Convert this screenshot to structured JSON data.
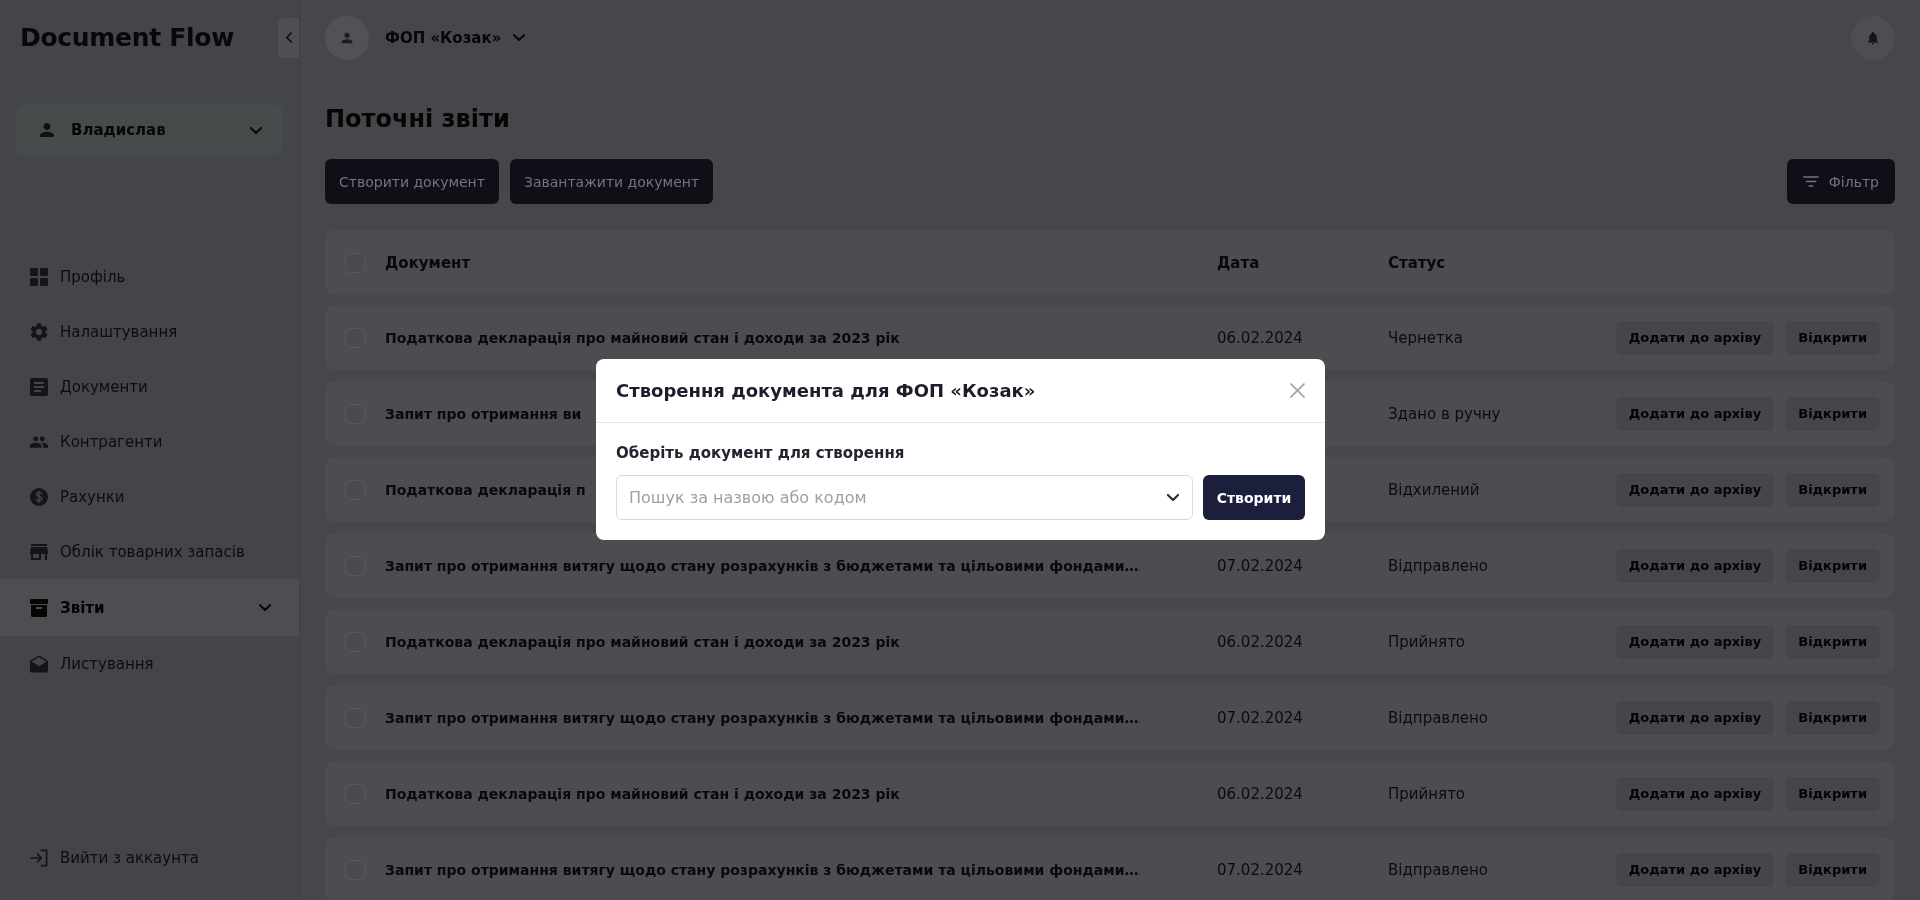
{
  "sidebar": {
    "logo": "Document Flow",
    "user": {
      "name": "Владислав"
    },
    "items": [
      {
        "label": "Профіль",
        "kind": "link",
        "selected": false
      },
      {
        "label": "Налаштування",
        "kind": "link",
        "selected": false
      },
      {
        "label": "Документи",
        "kind": "link",
        "selected": false
      },
      {
        "label": "Контрагенти",
        "kind": "link",
        "selected": false
      },
      {
        "label": "Рахунки",
        "kind": "link",
        "selected": false
      },
      {
        "label": "Облік товарних запасів",
        "kind": "link",
        "selected": false
      },
      {
        "label": "Звіти",
        "kind": "group",
        "selected": true
      },
      {
        "label": "Листування",
        "kind": "link",
        "selected": false
      }
    ],
    "logout": "Вийти з аккаунта"
  },
  "header": {
    "company": "ФОП «Козак»"
  },
  "page": {
    "title": "Поточні звіти",
    "actions": [
      "Створити документ",
      "Завантажити документ"
    ],
    "filter": "Фільтр"
  },
  "table": {
    "columns": [
      "Документ",
      "Дата",
      "Статус"
    ],
    "all_checked": false,
    "rows": [
      {
        "checked": false,
        "document": "Податкова декларація про майновий стан і доходи за 2023 рік",
        "date": "06.02.2024",
        "status": "Чернетка",
        "actions": [
          "Додати до архіву",
          "Відкрити"
        ]
      },
      {
        "checked": false,
        "document": "Запит про отримання ви",
        "status": "Здано в ручну",
        "actions": [
          "Додати до архіву",
          "Відкрити"
        ]
      },
      {
        "checked": false,
        "document": "Податкова декларація п",
        "status": "Відхилений",
        "actions": [
          "Додати до архіву",
          "Відкрити"
        ]
      },
      {
        "checked": false,
        "document": "Запит про отримання витягу щодо стану розрахунків з бюджетами та цільовими фондами…",
        "date": "07.02.2024",
        "status": "Відправлено",
        "actions": [
          "Додати до архіву",
          "Відкрити"
        ]
      },
      {
        "checked": false,
        "document": "Податкова декларація про майновий стан і доходи за 2023 рік",
        "date": "06.02.2024",
        "status": "Прийнято",
        "actions": [
          "Додати до архіву",
          "Відкрити"
        ]
      },
      {
        "checked": false,
        "document": "Запит про отримання витягу щодо стану розрахунків з бюджетами та цільовими фондами…",
        "date": "07.02.2024",
        "status": "Відправлено",
        "actions": [
          "Додати до архіву",
          "Відкрити"
        ]
      },
      {
        "checked": false,
        "document": "Податкова декларація про майновий стан і доходи за 2023 рік",
        "date": "06.02.2024",
        "status": "Прийнято",
        "actions": [
          "Додати до архіву",
          "Відкрити"
        ]
      },
      {
        "checked": false,
        "document": "Запит про отримання витягу щодо стану розрахунків з бюджетами та цільовими фондами…",
        "date": "07.02.2024",
        "status": "Відправлено",
        "actions": [
          "Додати до архіву",
          "Відкрити"
        ]
      }
    ]
  },
  "modal": {
    "title": "Створення документа для ФОП «Козак»",
    "label": "Оберіть документ для створення",
    "select": {
      "placeholder": "Пошук за назвою або кодом"
    },
    "submit": "Створити"
  }
}
